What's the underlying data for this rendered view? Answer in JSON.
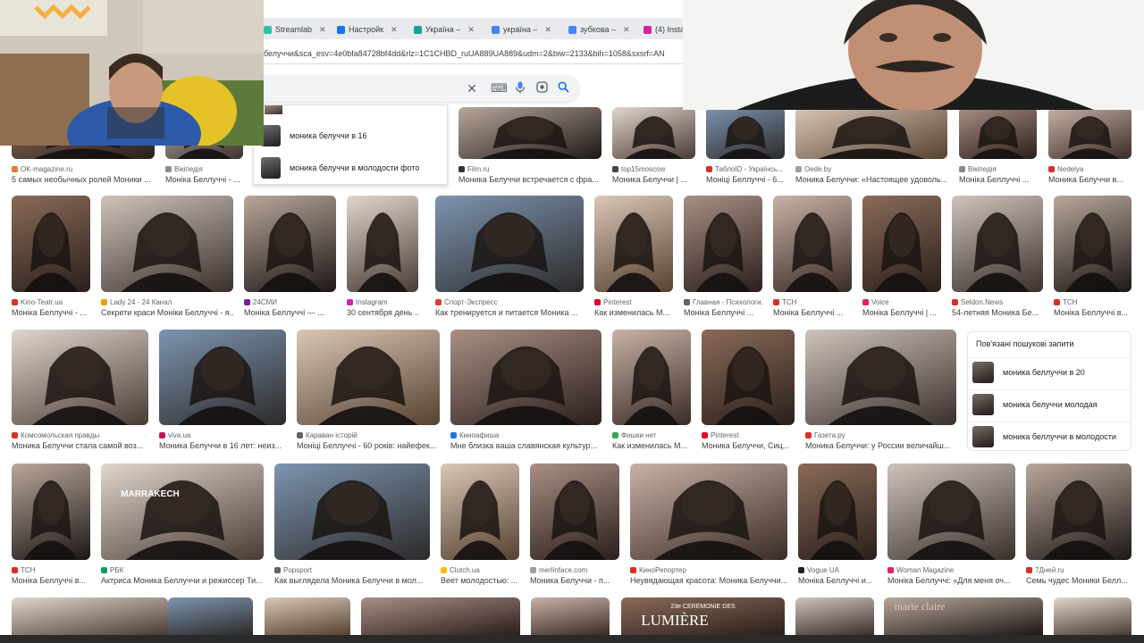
{
  "browser": {
    "tabs": [
      {
        "label": "Streamlab",
        "color": "#31c3a2"
      },
      {
        "label": "Настройк",
        "color": "#1a73e8"
      },
      {
        "label": "Україна –",
        "color": "#1aa09a"
      },
      {
        "label": "україна –",
        "color": "#4285f4"
      },
      {
        "label": "зубкова –",
        "color": "#4285f4"
      },
      {
        "label": "(4) Insta",
        "color": "#d6249f"
      }
    ],
    "url": "белуччи&sca_esv=4e0bfa84728bf4dd&rlz=1C1CHBD_ruUA889UA889&udm=2&biw=2133&bih=1058&sxsrf=AN"
  },
  "search": {
    "suggestions": [
      {
        "label": "моника белуччи в 16"
      },
      {
        "label": "моника белуччи в молодости фото"
      }
    ]
  },
  "results": [
    {
      "source": "OK-magazine.ru",
      "title": "5 самых необычных ролей Моники ...",
      "fav": "#e07b39"
    },
    {
      "source": "Вікіпедія",
      "title": "Моніка Беллуччі - ...",
      "fav": "#8a8a8a"
    },
    {
      "source": "Film.ru",
      "title": "Моника Белуччи встречается с фра...",
      "fav": "#333333"
    },
    {
      "source": "top15moscow",
      "title": "Моника Белуччи | ...",
      "fav": "#444444"
    },
    {
      "source": "ТаблоID - Українсь...",
      "title": "Моніці Беллуччі - 6...",
      "fav": "#d93025"
    },
    {
      "source": "Oede.by",
      "title": "Моника Белуччи: «Настоящее удоволь...",
      "fav": "#9aa0a6"
    },
    {
      "source": "Вікіпедія",
      "title": "Моніка Беллуччі ...",
      "fav": "#8a8a8a"
    },
    {
      "source": "Nedelya",
      "title": "Моника Белуччи в...",
      "fav": "#d93025"
    },
    {
      "source": "Kino-Teatr.ua",
      "title": "Моніка Беллуччі - ...",
      "fav": "#d93025"
    },
    {
      "source": "Lady 24 - 24 Канал",
      "title": "Секрети краси Моніки Беллуччі - я...",
      "fav": "#f29900"
    },
    {
      "source": "24СМИ",
      "title": "Моніка Беллуччі — ...",
      "fav": "#7b1fa2"
    },
    {
      "source": "Instagram",
      "title": "30 сентября день ...",
      "fav": "#d6249f"
    },
    {
      "source": "Спорт-Экспресс",
      "title": "Как тренируется и питается Моника ...",
      "fav": "#e53935"
    },
    {
      "source": "Pinterest",
      "title": "Как изменилась М...",
      "fav": "#e60023"
    },
    {
      "source": "Главная - Психологи...",
      "title": "Моніка Беллуччі ...",
      "fav": "#5f6368"
    },
    {
      "source": "ТСН",
      "title": "Моніка Беллуччі ...",
      "fav": "#d93025"
    },
    {
      "source": "Voice",
      "title": "Моніка Беллуччі | ...",
      "fav": "#e91e63"
    },
    {
      "source": "Seldon.News",
      "title": "54-летняя Моника Бе...",
      "fav": "#d93025"
    },
    {
      "source": "ТСН",
      "title": "Моніка Беллуччі в...",
      "fav": "#d93025"
    },
    {
      "source": "Комсомольская правды",
      "title": "Моника Белуччи стала самой воз...",
      "fav": "#d93025"
    },
    {
      "source": "viva.ua",
      "title": "Моника Белуччи в 16 лет: неиз...",
      "fav": "#c2185b"
    },
    {
      "source": "Караван історій",
      "title": "Моніці Беллуччі - 60 років: найефек...",
      "fav": "#5f6368"
    },
    {
      "source": "Киноафиша",
      "title": "Мне близка ваша славянская культур...",
      "fav": "#1a73e8"
    },
    {
      "source": "Фишки нет",
      "title": "Как изменилась М...",
      "fav": "#34a853"
    },
    {
      "source": "Pinterest",
      "title": "Моника Белуччи, Сиц...",
      "fav": "#e60023"
    },
    {
      "source": "Газета.ру",
      "title": "Моника Белуччи: у России величайш...",
      "fav": "#d93025"
    },
    {
      "source": "ТСН",
      "title": "Моніка Беллуччі в...",
      "fav": "#d93025"
    },
    {
      "source": "РБК",
      "title": "Актриса Моника Беллуччи и режиссер Ти...",
      "fav": "#0f9d58"
    },
    {
      "source": "Popsport",
      "title": "Как выглядела Моника Белуччи в мол...",
      "fav": "#5f6368"
    },
    {
      "source": "Clutch.ua",
      "title": "Веет молодостью: ...",
      "fav": "#fbbc04"
    },
    {
      "source": "merlinface.com",
      "title": "Моника Белуччи - п...",
      "fav": "#9aa0a6"
    },
    {
      "source": "КиноРепортер",
      "title": "Неувядающая красота: Моника Белуччи...",
      "fav": "#d93025"
    },
    {
      "source": "Vogue UA",
      "title": "Моніка Беллуччі и...",
      "fav": "#202124"
    },
    {
      "source": "Woman Magazine",
      "title": "Моніка Беллуччі: «Для меня оч...",
      "fav": "#e91e63"
    },
    {
      "source": "7Дней.ru",
      "title": "Семь чудес Моники Белл...",
      "fav": "#d93025"
    }
  ],
  "related": {
    "title": "Пов'язані пошукові запити",
    "items": [
      {
        "label": "моника беллуччи в 20"
      },
      {
        "label": "моника белуччи молодая"
      },
      {
        "label": "моника беллуччи в молодости"
      }
    ]
  },
  "overlays": {
    "banner_lumiere": "LUMIÈRE",
    "banner_ceremonie": "23e CÉRÉMONIE DES",
    "banner_marie": "marie claire",
    "banner_marrakech": "MARRAKECH"
  }
}
